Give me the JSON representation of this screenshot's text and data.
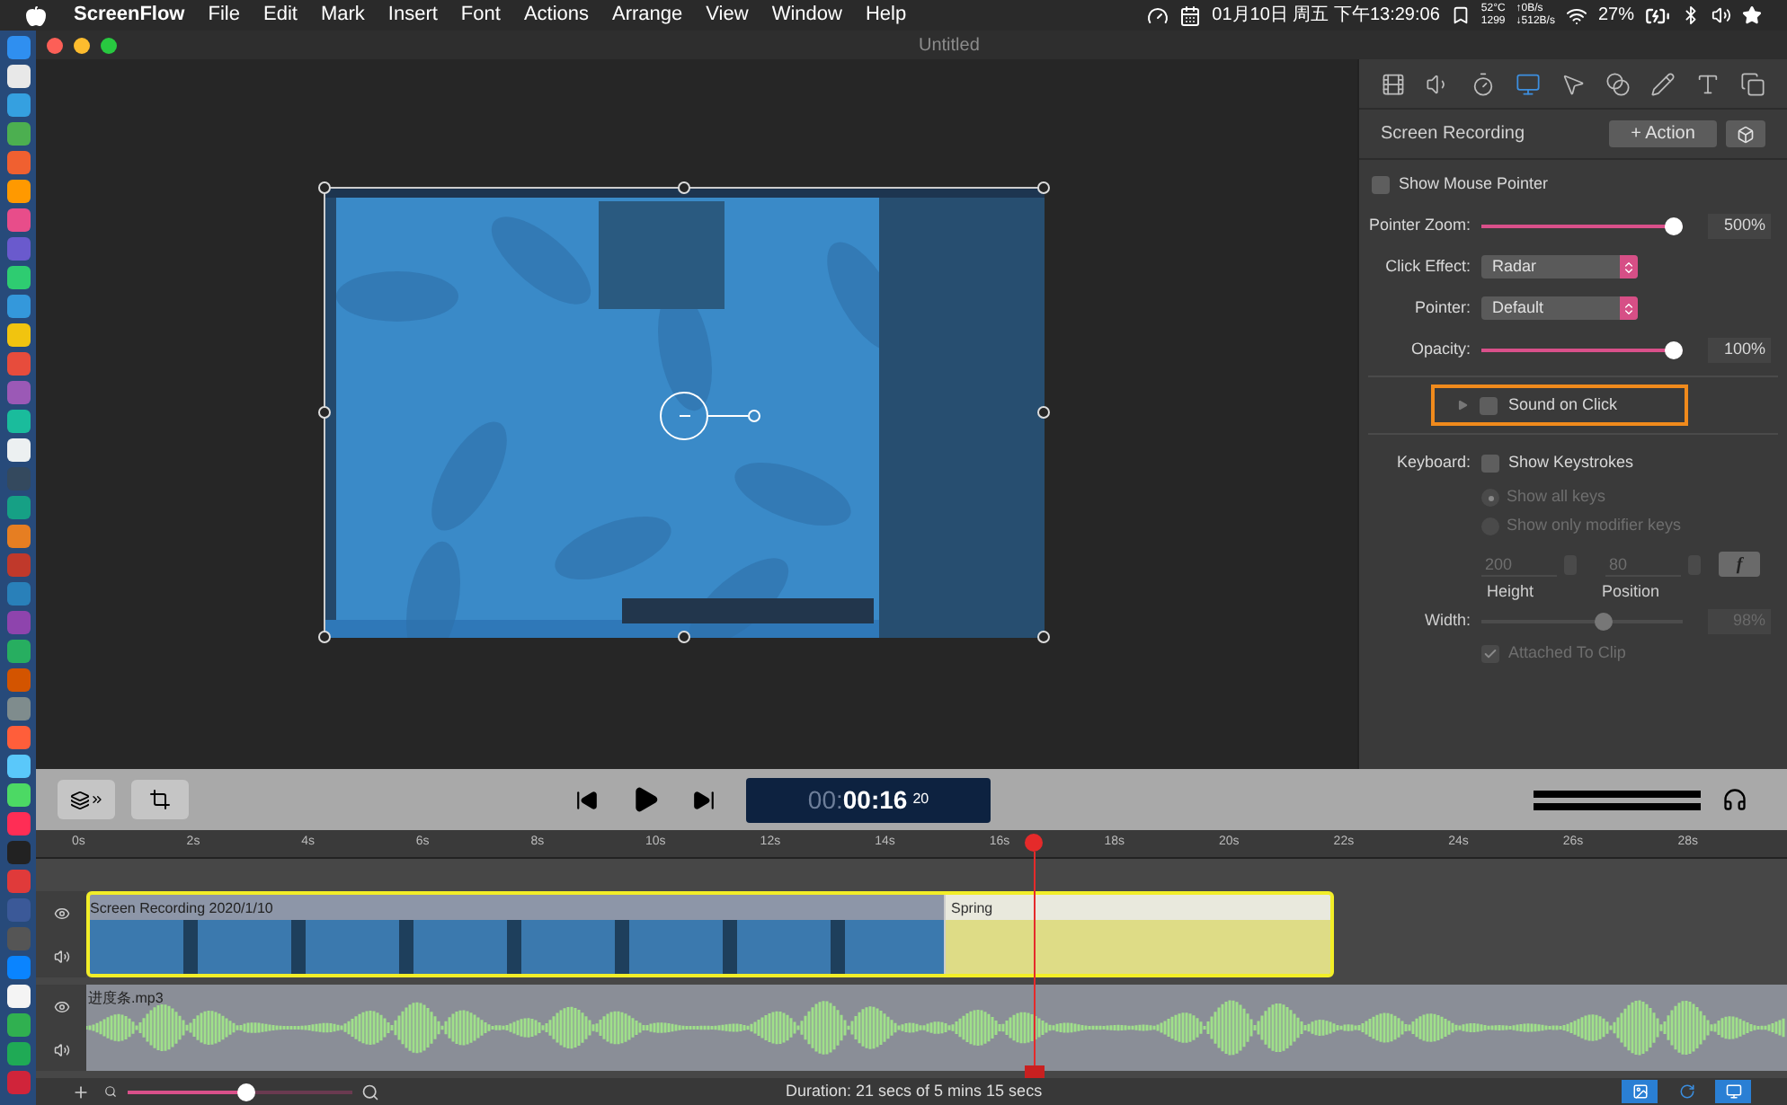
{
  "menu_bar": {
    "app_name": "ScreenFlow",
    "items": [
      "File",
      "Edit",
      "Mark",
      "Insert",
      "Font",
      "Actions",
      "Arrange",
      "View",
      "Window",
      "Help"
    ],
    "clock": "01月10日 周五 下午13:29:06",
    "temperature": "52°C",
    "fan_speed": "1299",
    "upload": "↑0B/s",
    "download": "↓512B/s",
    "battery": "27%"
  },
  "window": {
    "title": "Untitled"
  },
  "inspector": {
    "tabs": [
      {
        "kind": "video",
        "selected": false
      },
      {
        "kind": "audio",
        "selected": false
      },
      {
        "kind": "motion",
        "selected": false
      },
      {
        "kind": "screen",
        "selected": true
      },
      {
        "kind": "pointer",
        "selected": false
      },
      {
        "kind": "filters",
        "selected": false
      },
      {
        "kind": "annotation",
        "selected": false
      },
      {
        "kind": "text",
        "selected": false
      },
      {
        "kind": "layers",
        "selected": false
      }
    ],
    "heading": "Screen Recording",
    "action_button": "+ Action",
    "show_mouse_pointer": {
      "label": "Show Mouse Pointer",
      "checked": false
    },
    "pointer_zoom": {
      "label": "Pointer Zoom:",
      "level": 1,
      "reading": "500%"
    },
    "click_effect": {
      "label": "Click Effect:",
      "value": "Radar"
    },
    "pointer": {
      "label": "Pointer:",
      "value": "Default"
    },
    "opacity": {
      "label": "Opacity:",
      "level": 1,
      "reading": "100%"
    },
    "sound_on_click": {
      "label": "Sound on Click",
      "checked": false,
      "expanded": false
    },
    "keyboard": {
      "label": "Keyboard:",
      "show_keystrokes": {
        "label": "Show Keystrokes",
        "checked": false
      },
      "disabled": true,
      "modes": [
        {
          "label": "Show all keys",
          "selected": true
        },
        {
          "label": "Show only modifier keys",
          "selected": false
        }
      ],
      "height": {
        "value": "200",
        "label": "Height"
      },
      "position": {
        "value": "80",
        "label": "Position"
      },
      "function_button": "f",
      "width": {
        "label": "Width:",
        "level": 0.62,
        "reading": "98%"
      },
      "attached_to_clip": {
        "label": "Attached To Clip",
        "checked": true
      }
    }
  },
  "transport": {
    "timecode_dim": "00:",
    "timecode": "00:16",
    "frames": "20"
  },
  "timeline": {
    "ticks": [
      "0s",
      "2s",
      "4s",
      "6s",
      "8s",
      "10s",
      "12s",
      "14s",
      "16s",
      "18s",
      "20s",
      "22s",
      "24s",
      "26s",
      "28s"
    ],
    "playhead": {
      "level": 0.57
    },
    "tracks": [
      {
        "kind": "video",
        "title": "Screen Recording 2020/1/10",
        "selected": true,
        "action": "Spring"
      },
      {
        "kind": "audio",
        "title": "进度条.mp3",
        "selected": false
      }
    ]
  },
  "status": {
    "zoom": {
      "level": 0.53
    },
    "duration": "Duration: 21 secs of 5 mins 15 secs"
  }
}
